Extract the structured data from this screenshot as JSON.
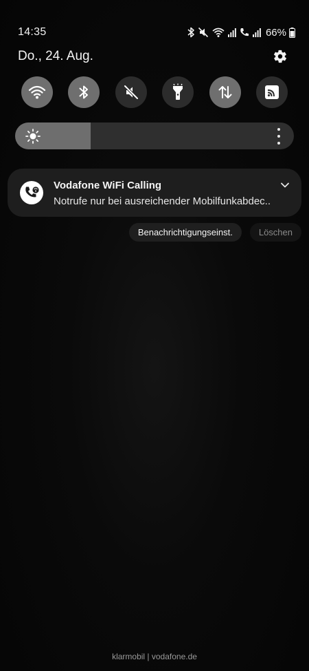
{
  "status_bar": {
    "time": "14:35",
    "battery_percent": "66%",
    "icons": [
      "bluetooth-icon",
      "mute-icon",
      "wifi-icon",
      "signal-icon",
      "wifi-calling-icon",
      "signal-icon",
      "battery-icon"
    ]
  },
  "header": {
    "date": "Do., 24. Aug.",
    "settings_icon": "gear-icon"
  },
  "quick_settings": [
    {
      "name": "wifi",
      "icon": "wifi-icon",
      "state": "on"
    },
    {
      "name": "bluetooth",
      "icon": "bluetooth-icon",
      "state": "on"
    },
    {
      "name": "sound",
      "icon": "mute-icon",
      "state": "off"
    },
    {
      "name": "flashlight",
      "icon": "flashlight-icon",
      "state": "off"
    },
    {
      "name": "mobile-data",
      "icon": "data-transfer-icon",
      "state": "on"
    },
    {
      "name": "cast",
      "icon": "cast-icon",
      "state": "off"
    }
  ],
  "brightness": {
    "level": 0.27,
    "icon": "sun-icon",
    "more_icon": "more-vertical-icon"
  },
  "notification": {
    "title": "Vodafone WiFi Calling",
    "text": "Notrufe nur bei ausreichender Mobilfunkabdec..",
    "icon": "wifi-calling-icon",
    "expand_icon": "chevron-down-icon"
  },
  "actions": {
    "settings_label": "Benachrichtigungseinst.",
    "clear_label": "Löschen"
  },
  "carrier": "klarmobil | vodafone.de",
  "colors": {
    "background": "#050505",
    "tile_on": "#6f6f6f",
    "tile_off": "#2c2c2c",
    "card": "#1e1e1e"
  }
}
